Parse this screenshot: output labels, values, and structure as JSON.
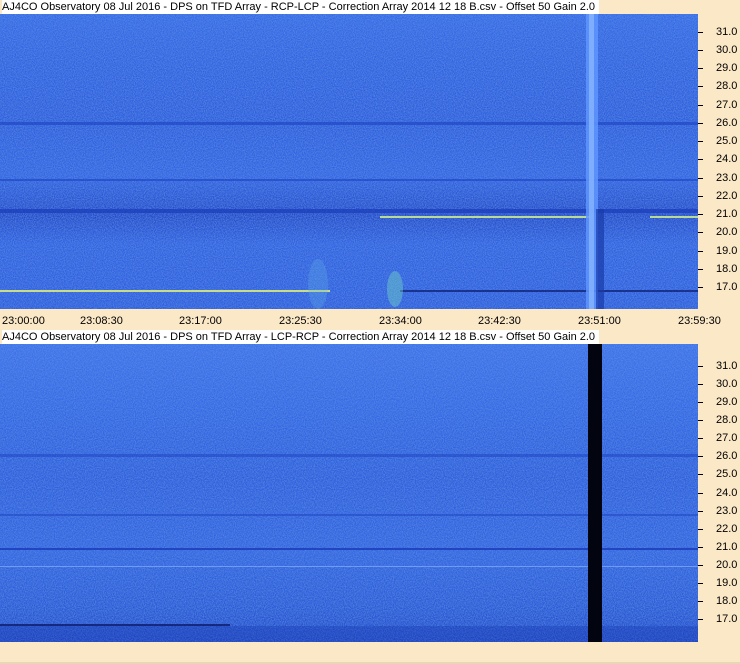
{
  "panels": [
    {
      "title": "AJ4CO Observatory 08 Jul 2016  -  DPS on TFD Array  -  RCP-LCP  -  Correction Array 2014 12 18 B.csv  -  Offset 50  Gain 2.0",
      "y_ticks": [
        "31.0",
        "30.0",
        "29.0",
        "28.0",
        "27.0",
        "26.0",
        "25.0",
        "24.0",
        "23.0",
        "22.0",
        "21.0",
        "20.0",
        "19.0",
        "18.0",
        "17.0"
      ],
      "x_ticks": [
        "23:00:00",
        "23:08:30",
        "23:17:00",
        "23:25:30",
        "23:34:00",
        "23:42:30",
        "23:51:00",
        "23:59:30"
      ]
    },
    {
      "title": "AJ4CO Observatory 08 Jul 2016  -  DPS on TFD Array  -  LCP-RCP  -  Correction Array 2014 12 18 B.csv  -  Offset 50  Gain 2.0",
      "y_ticks": [
        "31.0",
        "30.0",
        "29.0",
        "28.0",
        "27.0",
        "26.0",
        "25.0",
        "24.0",
        "23.0",
        "22.0",
        "21.0",
        "20.0",
        "19.0",
        "18.0",
        "17.0"
      ]
    }
  ],
  "colors": {
    "spectrogram_base": "#2b5fe6",
    "axis_background": "#fbe8c7"
  }
}
